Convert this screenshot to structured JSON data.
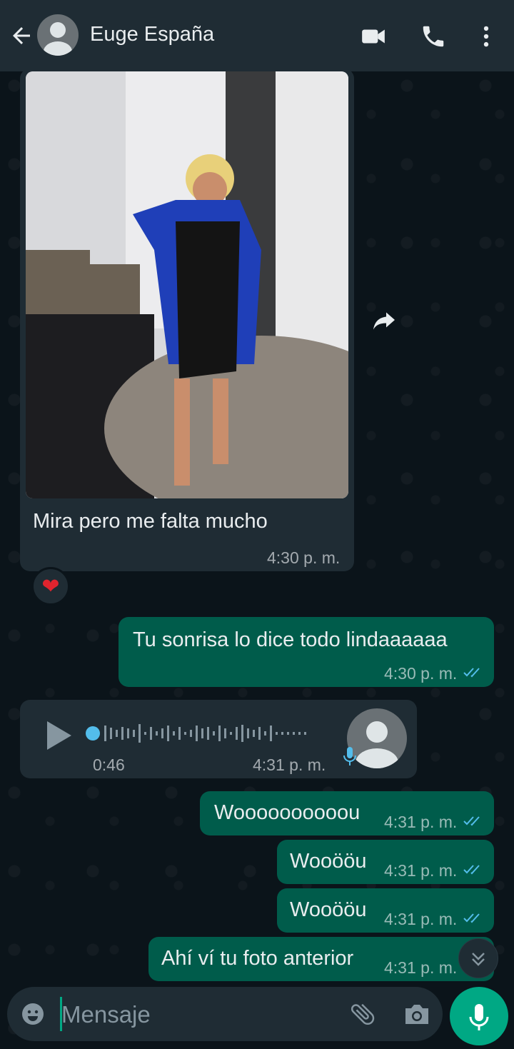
{
  "header": {
    "contact_name": "Euge España",
    "icons": [
      "back-arrow-icon",
      "avatar",
      "video-call-icon",
      "voice-call-icon",
      "more-options-icon"
    ]
  },
  "messages": [
    {
      "type": "image",
      "direction": "incoming",
      "caption": "Mira pero me falta mucho",
      "time": "4:30 p. m.",
      "reaction": "❤"
    },
    {
      "type": "text",
      "direction": "outgoing",
      "text": "Tu sonrisa lo dice todo lindaaaaaa",
      "time": "4:30 p. m."
    },
    {
      "type": "voice",
      "direction": "incoming",
      "duration": "0:46",
      "time": "4:31 p. m."
    },
    {
      "type": "text",
      "direction": "outgoing",
      "text": "Woooooooooou",
      "time": "4:31 p. m."
    },
    {
      "type": "text",
      "direction": "outgoing",
      "text": "Wooööu",
      "time": "4:31 p. m."
    },
    {
      "type": "text",
      "direction": "outgoing",
      "text": "Wooööu",
      "time": "4:31 p. m."
    },
    {
      "type": "text",
      "direction": "outgoing",
      "text": "Ahí ví tu foto anterior",
      "time": "4:31 p. m."
    }
  ],
  "input": {
    "placeholder": "Mensaje"
  },
  "colors": {
    "background": "#0b141a",
    "header": "#1f2c34",
    "incoming_bubble": "#1f2c34",
    "outgoing_bubble": "#005c4b",
    "accent": "#00a884",
    "read_ticks": "#53bdeb"
  }
}
